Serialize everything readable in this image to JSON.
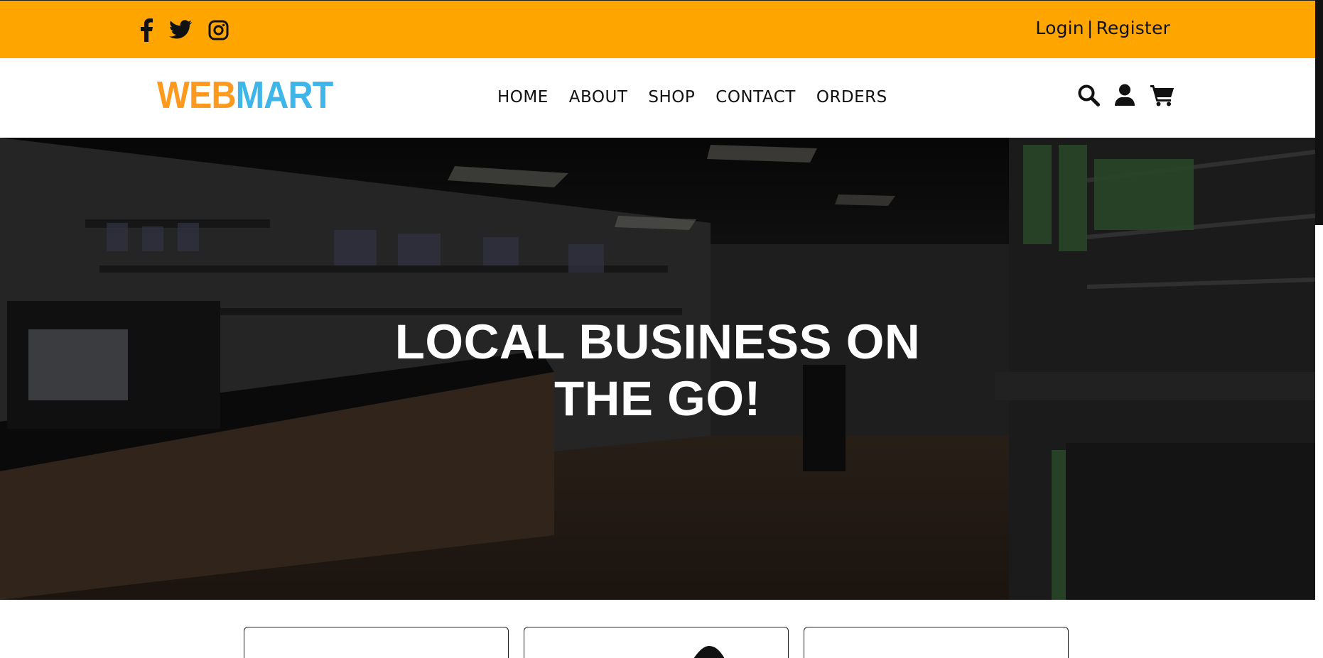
{
  "topbar": {
    "social": [
      {
        "icon": "facebook-icon"
      },
      {
        "icon": "twitter-icon"
      },
      {
        "icon": "instagram-icon"
      }
    ],
    "login_label": "Login",
    "separator": "|",
    "register_label": "Register",
    "background": "#ffa500"
  },
  "brand": {
    "logo_part1": "WEB",
    "logo_part2": "MART",
    "color1": "#ff9a1f",
    "color2": "#3fb6ea"
  },
  "nav": {
    "items": [
      {
        "label": "HOME"
      },
      {
        "label": "ABOUT"
      },
      {
        "label": "SHOP"
      },
      {
        "label": "CONTACT"
      },
      {
        "label": "ORDERS"
      }
    ]
  },
  "tools": [
    {
      "icon": "search-icon"
    },
    {
      "icon": "user-icon"
    },
    {
      "icon": "cart-icon"
    }
  ],
  "hero": {
    "title_line1": "LOCAL BUSINESS ON",
    "title_line2": "THE GO!"
  },
  "products": {
    "cards": [
      {},
      {},
      {}
    ]
  }
}
